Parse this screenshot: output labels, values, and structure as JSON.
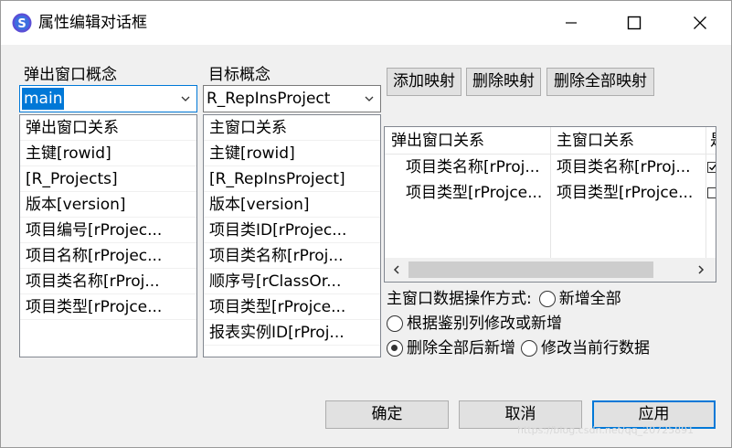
{
  "window": {
    "title": "属性编辑对话框",
    "minimize_icon": "minimize-icon",
    "maximize_icon": "maximize-icon",
    "close_icon": "close-icon"
  },
  "popup_concept": {
    "label": "弹出窗口概念",
    "selected": "main",
    "items": [
      "弹出窗口关系",
      "主键[rowid]",
      "[R_Projects]",
      "版本[version]",
      "项目编号[rProjec...",
      "项目名称[rProjec...",
      "项目类名称[rProj...",
      "项目类型[rProjce..."
    ]
  },
  "target_concept": {
    "label": "目标概念",
    "selected": "R_RepInsProject",
    "items": [
      "主窗口关系",
      "主键[rowid]",
      "[R_RepInsProject]",
      "版本[version]",
      "项目类ID[rProjec...",
      "项目类名称[rProj...",
      "顺序号[rClassOr...",
      "项目类型[rProjce...",
      "报表实例ID[rProj..."
    ]
  },
  "mapping_buttons": {
    "add": "添加映射",
    "delete": "删除映射",
    "delete_all": "删除全部映射"
  },
  "mapping_grid": {
    "headers": [
      "弹出窗口关系",
      "主窗口关系",
      "是"
    ],
    "rows": [
      {
        "popup": "项目类名称[rProj...",
        "main": "项目类名称[rProj...",
        "checked": true
      },
      {
        "popup": "项目类型[rProjce...",
        "main": "项目类型[rProjce...",
        "checked": false
      }
    ]
  },
  "operation_mode": {
    "label": "主窗口数据操作方式:",
    "options": [
      "新增全部",
      "根据鉴别列修改或新增",
      "删除全部后新增",
      "修改当前行数据"
    ],
    "selected_index": 2
  },
  "footer": {
    "ok": "确定",
    "cancel": "取消",
    "apply": "应用",
    "watermark": "https://blog.csdn.net/qq_20725891"
  }
}
